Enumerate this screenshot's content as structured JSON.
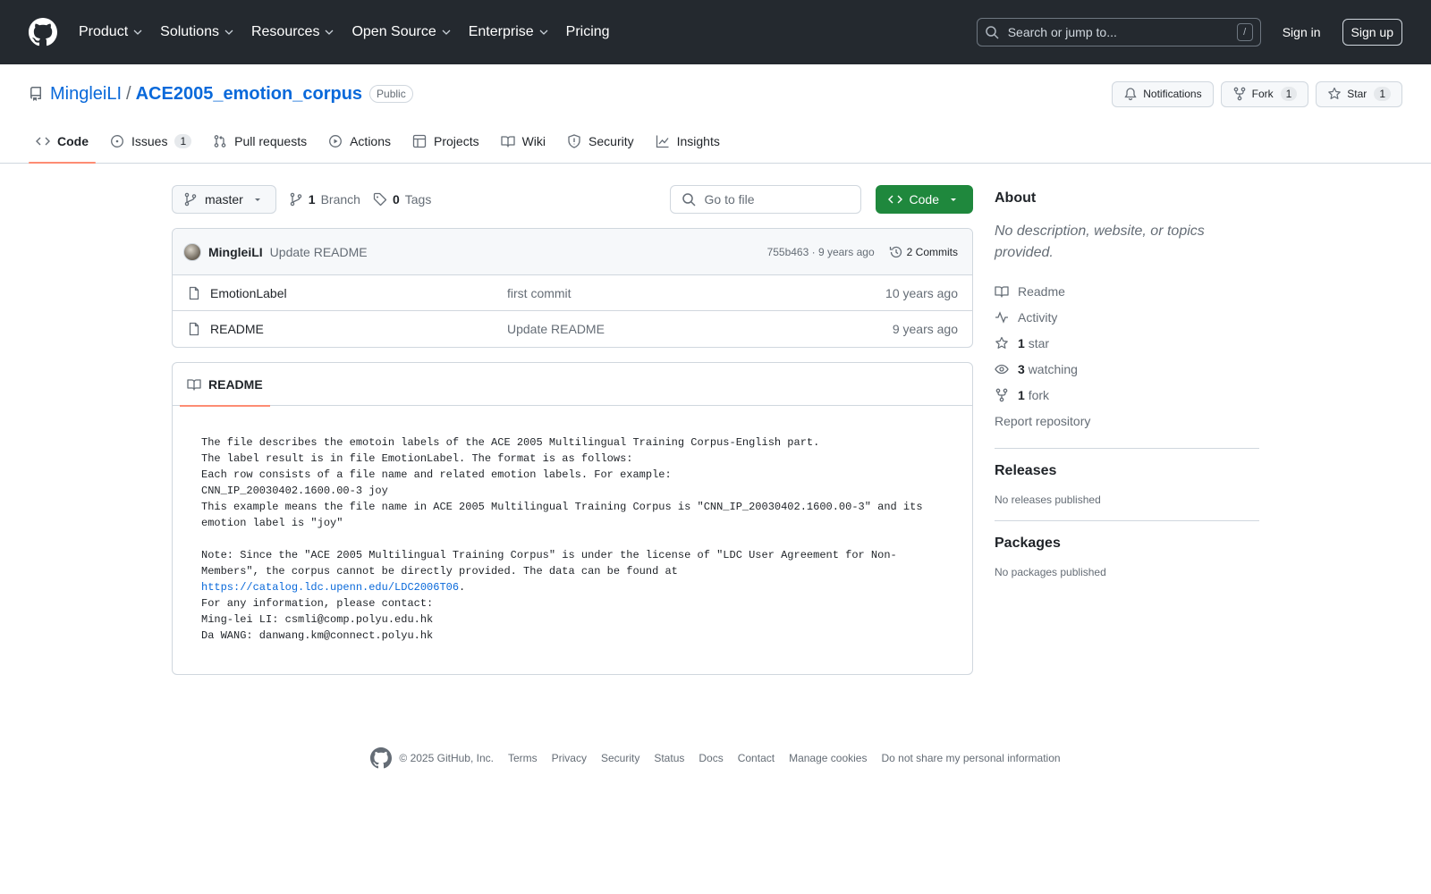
{
  "header": {
    "nav": [
      "Product",
      "Solutions",
      "Resources",
      "Open Source",
      "Enterprise",
      "Pricing"
    ],
    "search_placeholder": "Search or jump to...",
    "search_shortcut": "/",
    "signin": "Sign in",
    "signup": "Sign up"
  },
  "repo": {
    "owner": "MingleiLI",
    "separator": "/",
    "name": "ACE2005_emotion_corpus",
    "visibility": "Public",
    "notifications": "Notifications",
    "fork_label": "Fork",
    "fork_count": "1",
    "star_label": "Star",
    "star_count": "1"
  },
  "tabs": {
    "code": "Code",
    "issues": "Issues",
    "issues_count": "1",
    "pulls": "Pull requests",
    "actions": "Actions",
    "projects": "Projects",
    "wiki": "Wiki",
    "security": "Security",
    "insights": "Insights"
  },
  "filenav": {
    "branch": "master",
    "branch_count": "1",
    "branch_label": "Branch",
    "tag_count": "0",
    "tag_label": "Tags",
    "goto_placeholder": "Go to file",
    "code_button": "Code"
  },
  "commit": {
    "author": "MingleiLI",
    "message": "Update README",
    "sha_age": "755b463 · 9 years ago",
    "commits": "2 Commits"
  },
  "files": [
    {
      "name": "EmotionLabel",
      "message": "first commit",
      "age": "10 years ago"
    },
    {
      "name": "README",
      "message": "Update README",
      "age": "9 years ago"
    }
  ],
  "readme": {
    "title": "README",
    "text_before_link": "The file describes the emotoin labels of the ACE 2005 Multilingual Training Corpus-English part.\nThe label result is in file EmotionLabel. The format is as follows:\nEach row consists of a file name and related emotion labels. For example:\nCNN_IP_20030402.1600.00-3 joy\nThis example means the file name in ACE 2005 Multilingual Training Corpus is \"CNN_IP_20030402.1600.00-3\" and its emotion label is \"joy\"\n\nNote: Since the \"ACE 2005 Multilingual Training Corpus\" is under the license of \"LDC User Agreement for Non-Members\", the corpus cannot be directly provided. The data can be found at\n",
    "link": "https://catalog.ldc.upenn.edu/LDC2006T06",
    "text_after_link": ".\nFor any information, please contact:\nMing-lei LI: csmli@comp.polyu.edu.hk\nDa WANG: danwang.km@connect.polyu.hk"
  },
  "about": {
    "title": "About",
    "description": "No description, website, or topics provided.",
    "readme": "Readme",
    "activity": "Activity",
    "stars_count": "1",
    "stars_label": "star",
    "watching_count": "3",
    "watching_label": "watching",
    "forks_count": "1",
    "forks_label": "fork",
    "report": "Report repository"
  },
  "releases": {
    "title": "Releases",
    "empty": "No releases published"
  },
  "packages": {
    "title": "Packages",
    "empty": "No packages published"
  },
  "footer": {
    "copyright": "© 2025 GitHub, Inc.",
    "links": [
      "Terms",
      "Privacy",
      "Security",
      "Status",
      "Docs",
      "Contact",
      "Manage cookies",
      "Do not share my personal information"
    ]
  },
  "colors": {
    "header_bg": "#24292f",
    "link": "#0969da",
    "code_button": "#1f883d",
    "tab_underline": "#fd8c73"
  }
}
